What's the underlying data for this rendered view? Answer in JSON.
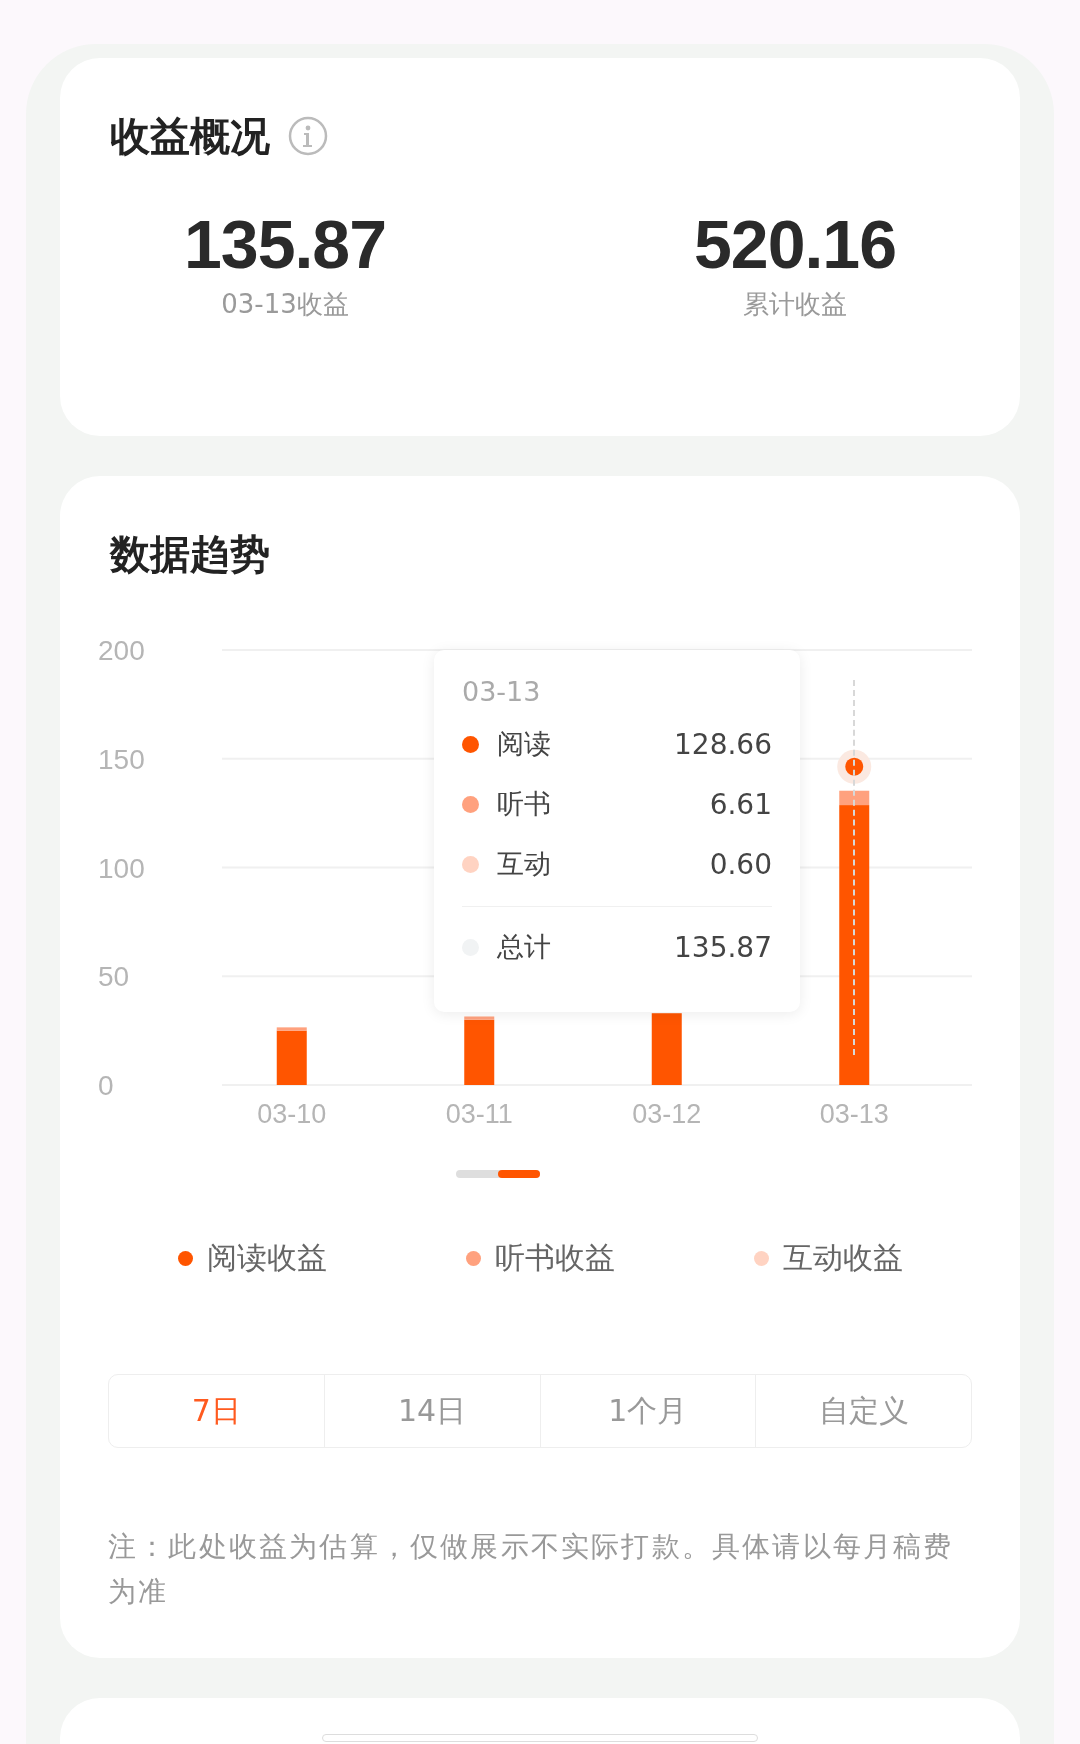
{
  "overview": {
    "title": "收益概况",
    "stats": [
      {
        "value": "135.87",
        "label": "03-13收益"
      },
      {
        "value": "520.16",
        "label": "累计收益"
      }
    ]
  },
  "trend": {
    "title": "数据趋势",
    "chart_data": {
      "type": "bar",
      "stacked": true,
      "grid": true,
      "categories": [
        "03-10",
        "03-11",
        "03-12",
        "03-13"
      ],
      "series": [
        {
          "name": "阅读收益",
          "color": "#ff5500",
          "values": [
            25,
            30,
            33,
            128.7
          ]
        },
        {
          "name": "听书收益",
          "color": "#ffa17e",
          "values": [
            1.5,
            1.5,
            null,
            6.6
          ]
        },
        {
          "name": "互动收益",
          "color": "#ffd3c2",
          "values": [
            null,
            null,
            null,
            null
          ]
        }
      ],
      "ylim": [
        0,
        200
      ],
      "yticks": [
        0,
        50,
        100,
        150,
        200
      ]
    },
    "tooltip": {
      "date": "03-13",
      "rows": [
        {
          "label": "阅读",
          "value": "128.66",
          "color": "#ff5500"
        },
        {
          "label": "听书",
          "value": "6.61",
          "color": "#ffa17e"
        },
        {
          "label": "互动",
          "value": "0.60",
          "color": "#ffd3c2"
        }
      ],
      "total": {
        "label": "总计",
        "value": "135.87",
        "color": "#f1f3f4"
      }
    },
    "ranges": [
      {
        "label": "7日",
        "selected": true
      },
      {
        "label": "14日",
        "selected": false
      },
      {
        "label": "1个月",
        "selected": false
      },
      {
        "label": "自定义",
        "selected": false
      }
    ],
    "note": "注：此处收益为估算，仅做展示不实际打款。具体请以每月稿费为准"
  }
}
